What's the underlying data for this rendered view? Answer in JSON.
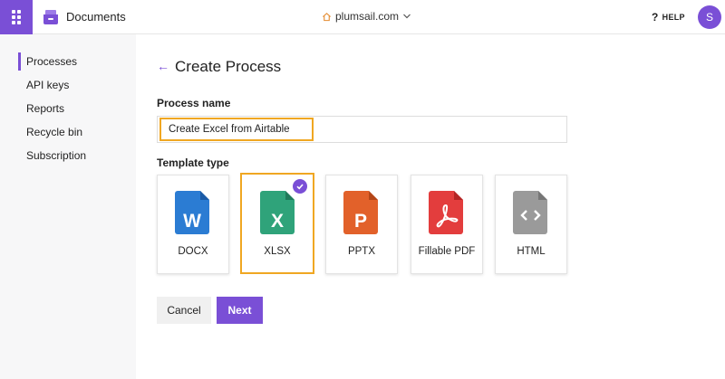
{
  "header": {
    "app_title": "Documents",
    "domain": "plumsail.com",
    "help_label": "HELP",
    "avatar_initial": "S",
    "accent_color": "#7a4fd6"
  },
  "sidebar": {
    "items": [
      {
        "label": "Processes",
        "active": true
      },
      {
        "label": "API keys"
      },
      {
        "label": "Reports"
      },
      {
        "label": "Recycle bin"
      },
      {
        "label": "Subscription"
      }
    ]
  },
  "main": {
    "title": "Create Process",
    "process_name_label": "Process name",
    "process_name_value": "Create Excel from Airtable",
    "template_type_label": "Template type",
    "templates": [
      {
        "label": "DOCX",
        "letter": "W",
        "color": "#2b7cd3",
        "selected": false
      },
      {
        "label": "XLSX",
        "letter": "X",
        "color": "#2fa37a",
        "selected": true
      },
      {
        "label": "PPTX",
        "letter": "P",
        "color": "#e2612a",
        "selected": false
      },
      {
        "label": "Fillable PDF",
        "letter": "pdf-symbol",
        "color": "#e33d3d",
        "selected": false
      },
      {
        "label": "HTML",
        "letter": "<>",
        "color": "#9a9a9a",
        "selected": false
      }
    ],
    "cancel_label": "Cancel",
    "next_label": "Next",
    "highlight_color": "#f0a722"
  }
}
